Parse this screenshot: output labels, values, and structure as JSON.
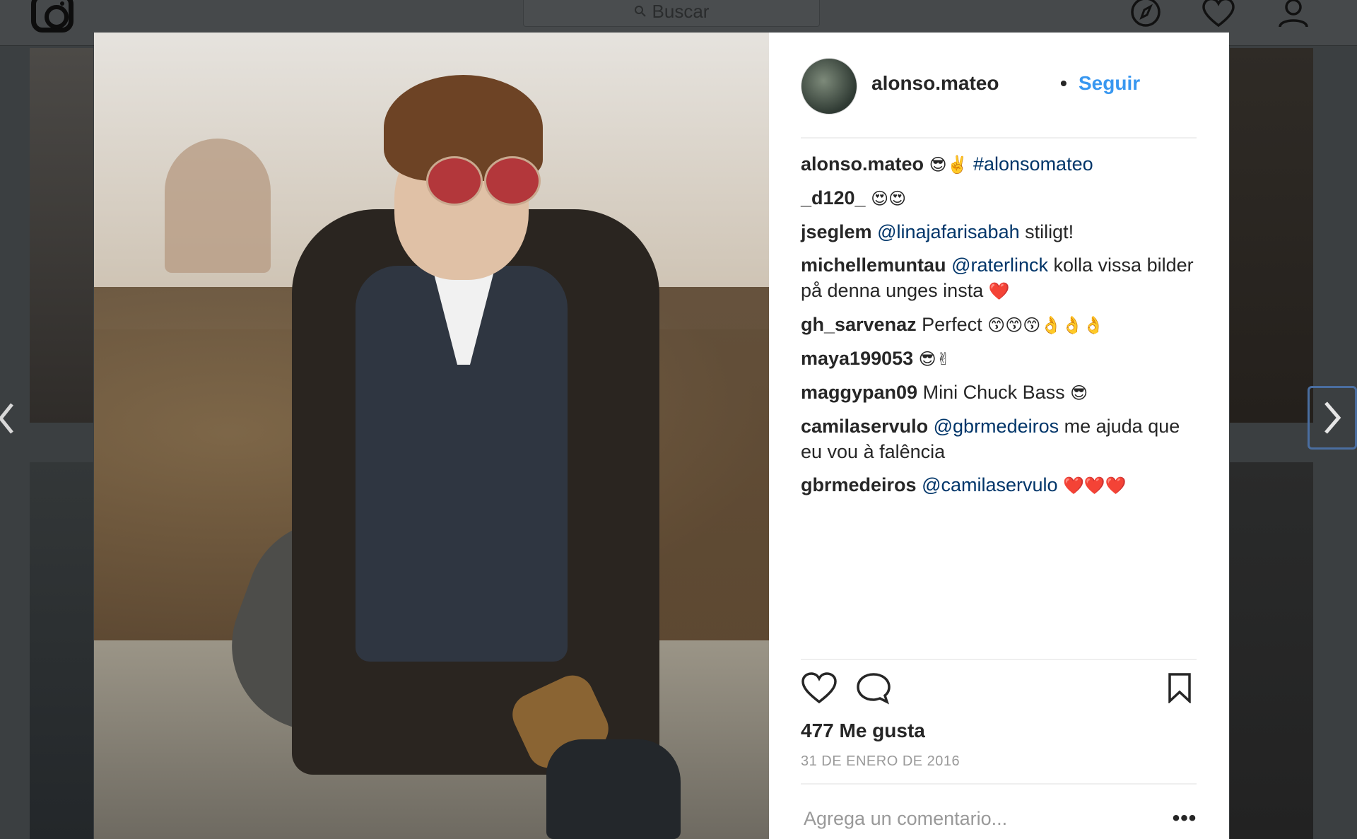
{
  "topbar": {
    "search_placeholder": "Buscar",
    "icons": [
      "instagram-logo-icon",
      "search-icon",
      "compass-icon",
      "heart-icon",
      "profile-icon"
    ]
  },
  "post": {
    "author": "alonso.mateo",
    "separator": "•",
    "follow_label": "Seguir",
    "comments": [
      {
        "user": "alonso.mateo",
        "segments": [
          {
            "t": "😎✌️",
            "k": "emoji"
          },
          {
            "t": "#alonsomateo",
            "k": "mention"
          }
        ]
      },
      {
        "user": "_d120_",
        "segments": [
          {
            "t": "😍😍",
            "k": "emoji"
          }
        ]
      },
      {
        "user": "jseglem",
        "segments": [
          {
            "t": "@linajafarisabah",
            "k": "mention"
          },
          {
            "t": "stiligt!",
            "k": "text"
          }
        ]
      },
      {
        "user": "michellemuntau",
        "segments": [
          {
            "t": "@raterlinck",
            "k": "mention"
          },
          {
            "t": "kolla vissa bilder på denna unges insta",
            "k": "text"
          },
          {
            "t": "❤️",
            "k": "emoji"
          }
        ]
      },
      {
        "user": "gh_sarvenaz",
        "segments": [
          {
            "t": "Perfect",
            "k": "text"
          },
          {
            "t": "😙😙😙👌👌👌",
            "k": "emoji"
          }
        ]
      },
      {
        "user": "maya199053",
        "segments": [
          {
            "t": "😎✌",
            "k": "emoji"
          }
        ]
      },
      {
        "user": "maggypan09",
        "segments": [
          {
            "t": "Mini Chuck Bass",
            "k": "text"
          },
          {
            "t": "😎",
            "k": "emoji"
          }
        ]
      },
      {
        "user": "camilaservulo",
        "segments": [
          {
            "t": "@gbrmedeiros",
            "k": "mention"
          },
          {
            "t": "me ajuda que eu vou à falência",
            "k": "text"
          }
        ]
      },
      {
        "user": "gbrmedeiros",
        "segments": [
          {
            "t": "@camilaservulo",
            "k": "mention"
          },
          {
            "t": "❤️❤️❤️",
            "k": "emoji"
          }
        ]
      }
    ],
    "likes_label": "477 Me gusta",
    "date_label": "31 DE ENERO DE 2016",
    "comment_placeholder": "Agrega un comentario...",
    "more_label": "•••",
    "colors": {
      "link": "#3897f0",
      "mention": "#003569",
      "text": "#262626",
      "muted": "#999999"
    }
  },
  "navigation": {
    "prev_icon": "chevron-left-icon",
    "next_icon": "chevron-right-icon"
  }
}
